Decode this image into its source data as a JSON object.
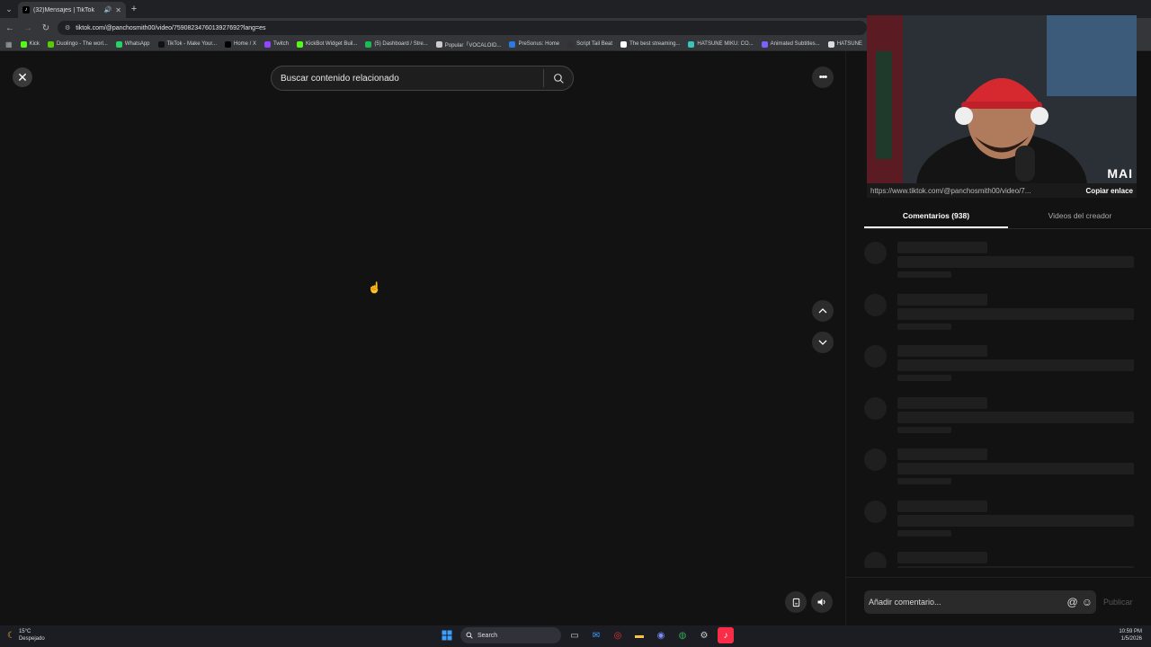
{
  "browser": {
    "tab_title": "(32)Mensajes | TikTok",
    "tab_favicon": "♪",
    "new_tab": "+",
    "url": "tiktok.com/@panchosmith00/video/7590823476013927692?lang=es",
    "bookmarks": [
      {
        "label": "Kick",
        "color": "#53fc18"
      },
      {
        "label": "Duolingo - The worl...",
        "color": "#58cc02"
      },
      {
        "label": "WhatsApp",
        "color": "#25d366"
      },
      {
        "label": "TikTok - Make Your...",
        "color": "#111111"
      },
      {
        "label": "Home / X",
        "color": "#000000"
      },
      {
        "label": "Twitch",
        "color": "#9146ff"
      },
      {
        "label": "KickBot Widget Buil...",
        "color": "#53fc18"
      },
      {
        "label": "(5) Dashboard / Stre...",
        "color": "#1db954"
      },
      {
        "label": "Popular「VOCALOID...",
        "color": "#cccccc"
      },
      {
        "label": "PreSonus: Home",
        "color": "#2a7ae2"
      },
      {
        "label": "Script Tail Beat",
        "color": "#333333"
      },
      {
        "label": "The best streaming...",
        "color": "#ffffff"
      },
      {
        "label": "HATSUNE MIKU: CO...",
        "color": "#39c5bb"
      },
      {
        "label": "Animated Subtitles...",
        "color": "#7b61ff"
      },
      {
        "label": "HATSUNE",
        "color": "#dddddd"
      }
    ]
  },
  "page": {
    "search_placeholder": "Buscar contenido relacionado",
    "close_symbol": "✕",
    "more_symbol": "•••"
  },
  "right_panel": {
    "webcam_label": "MAI",
    "video_link": "https://www.tiktok.com/@panchosmith00/video/7...",
    "copy_link_label": "Copiar enlace",
    "tabs": [
      {
        "label": "Comentarios (938)",
        "active": true
      },
      {
        "label": "Videos del creador",
        "active": false
      }
    ],
    "comment_placeholder": "Añadir comentario...",
    "at_symbol": "@",
    "emoji_symbol": "☺",
    "publish_label": "Publicar"
  },
  "taskbar": {
    "weather_temp": "15°C",
    "weather_desc": "Despejado",
    "search_label": "Search",
    "time": "10:59 PM",
    "date": "1/5/2026"
  }
}
